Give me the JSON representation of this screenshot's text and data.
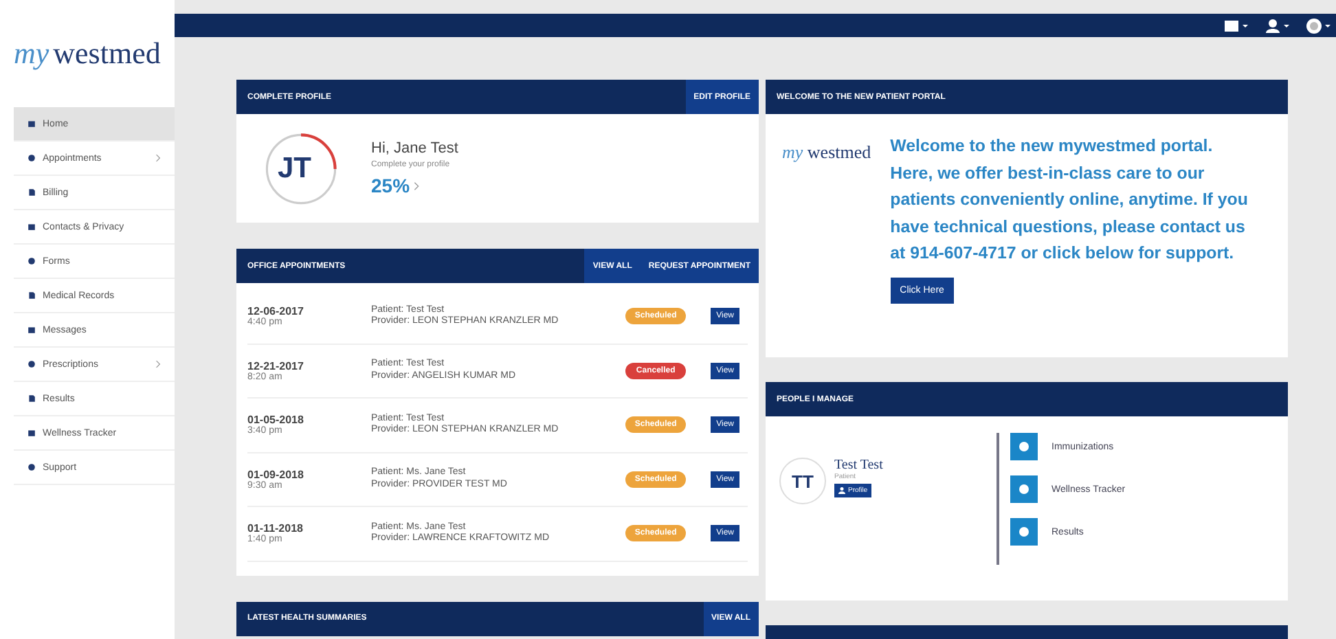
{
  "logo": {
    "script": "my",
    "word": "westmed"
  },
  "sidebar": {
    "items": [
      {
        "label": "Home",
        "selected": true,
        "submenu": false
      },
      {
        "label": "Appointments",
        "selected": false,
        "submenu": true
      },
      {
        "label": "Billing",
        "selected": false,
        "submenu": false
      },
      {
        "label": "Contacts & Privacy",
        "selected": false,
        "submenu": false
      },
      {
        "label": "Forms",
        "selected": false,
        "submenu": false
      },
      {
        "label": "Medical Records",
        "selected": false,
        "submenu": false
      },
      {
        "label": "Messages",
        "selected": false,
        "submenu": false
      },
      {
        "label": "Prescriptions",
        "selected": false,
        "submenu": true
      },
      {
        "label": "Results",
        "selected": false,
        "submenu": false
      },
      {
        "label": "Wellness Tracker",
        "selected": false,
        "submenu": false
      },
      {
        "label": "Support",
        "selected": false,
        "submenu": false
      }
    ]
  },
  "profile": {
    "title": "COMPLETE PROFILE",
    "action": "EDIT PROFILE",
    "initials": "JT",
    "greeting": "Hi, Jane Test",
    "hint": "Complete your profile",
    "percent": "25%",
    "level": 0.25
  },
  "appointments": {
    "title": "OFFICE APPOINTMENTS",
    "actions": [
      "VIEW ALL",
      "REQUEST APPOINTMENT"
    ],
    "rows": [
      {
        "date": "12-06-2017",
        "time": "4:40 pm",
        "patient": "Patient: Test Test",
        "provider": "Provider: LEON STEPHAN KRANZLER MD",
        "status": "Scheduled",
        "kind": "scheduled",
        "button": "View"
      },
      {
        "date": "12-21-2017",
        "time": "8:20 am",
        "patient": "Patient: Test Test",
        "provider": "Provider: ANGELISH KUMAR MD",
        "status": "Cancelled",
        "kind": "cancelled",
        "button": "View"
      },
      {
        "date": "01-05-2018",
        "time": "3:40 pm",
        "patient": "Patient: Test Test",
        "provider": "Provider: LEON STEPHAN KRANZLER MD",
        "status": "Scheduled",
        "kind": "scheduled",
        "button": "View"
      },
      {
        "date": "01-09-2018",
        "time": "9:30 am",
        "patient": "Patient: Ms. Jane Test",
        "provider": "Provider: PROVIDER TEST MD",
        "status": "Scheduled",
        "kind": "scheduled",
        "button": "View"
      },
      {
        "date": "01-11-2018",
        "time": "1:40 pm",
        "patient": "Patient: Ms. Jane Test",
        "provider": "Provider: LAWRENCE KRAFTOWITZ MD",
        "status": "Scheduled",
        "kind": "scheduled",
        "button": "View"
      }
    ]
  },
  "health_summaries": {
    "title": "LATEST HEALTH SUMMARIES",
    "action": "VIEW ALL"
  },
  "welcome": {
    "title": "WELCOME TO THE NEW PATIENT PORTAL",
    "logo": {
      "script": "my",
      "word": "westmed"
    },
    "message": "Welcome to the new mywestmed portal. Here, we offer best-in-class care to our patients conveniently online, anytime. If you have technical questions, please contact us at 914-607-4717 or click below for support.",
    "button": "Click Here"
  },
  "people": {
    "title": "PEOPLE I MANAGE",
    "initials": "TT",
    "name": "Test Test",
    "role": "Patient",
    "button": "Profile",
    "links": [
      "Immunizations",
      "Wellness Tracker",
      "Results"
    ]
  }
}
